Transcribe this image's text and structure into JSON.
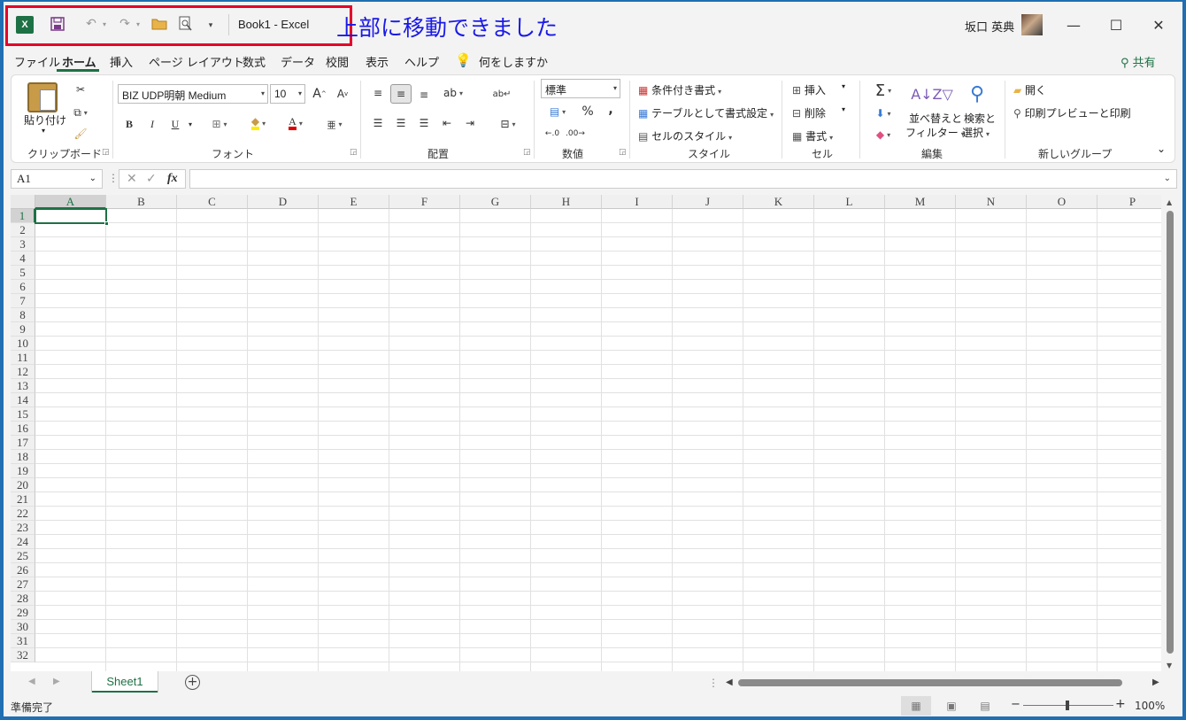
{
  "titlebar": {
    "doc_title": "Book1  -  Excel",
    "annotation": "上部に移動できました",
    "user_name": "坂口 英典",
    "excel_logo": "X",
    "minimize": "—",
    "maximize": "☐",
    "close": "✕"
  },
  "tabs": [
    {
      "label": "ファイル"
    },
    {
      "label": "ホーム"
    },
    {
      "label": "挿入"
    },
    {
      "label": "ページ レイアウト"
    },
    {
      "label": "数式"
    },
    {
      "label": "データ"
    },
    {
      "label": "校閲"
    },
    {
      "label": "表示"
    },
    {
      "label": "ヘルプ"
    }
  ],
  "tell_me": "何をしますか",
  "share": "共有",
  "ribbon": {
    "clipboard": {
      "paste": "貼り付け",
      "label": "クリップボード"
    },
    "font": {
      "name": "BIZ UDP明朝 Medium",
      "size": "10",
      "label": "フォント",
      "bold": "B",
      "italic": "I",
      "underline": "U"
    },
    "alignment": {
      "label": "配置"
    },
    "number": {
      "format": "標準",
      "label": "数値",
      "percent": "%",
      "comma": ","
    },
    "styles": {
      "conditional": "条件付き書式",
      "table": "テーブルとして書式設定",
      "cell_styles": "セルのスタイル",
      "label": "スタイル"
    },
    "cells": {
      "insert": "挿入",
      "delete": "削除",
      "format": "書式",
      "label": "セル"
    },
    "editing": {
      "sort_filter_1": "並べ替えと",
      "sort_filter_2": "フィルター",
      "find_1": "検索と",
      "find_2": "選択",
      "label": "編集"
    },
    "new_group": {
      "open": "開く",
      "print_preview": "印刷プレビューと印刷",
      "label": "新しいグループ"
    }
  },
  "formula_bar": {
    "name_box": "A1",
    "fx": "fx",
    "value": ""
  },
  "grid": {
    "columns": [
      "A",
      "B",
      "C",
      "D",
      "E",
      "F",
      "G",
      "H",
      "I",
      "J",
      "K",
      "L",
      "M",
      "N",
      "O",
      "P"
    ],
    "rows": [
      "1",
      "2",
      "3",
      "4",
      "5",
      "6",
      "7",
      "8",
      "9",
      "10",
      "11",
      "12",
      "13",
      "14",
      "15",
      "16",
      "17",
      "18",
      "19",
      "20",
      "21",
      "22",
      "23",
      "24",
      "25",
      "26",
      "27",
      "28",
      "29",
      "30",
      "31",
      "32"
    ],
    "active_cell": "A1"
  },
  "sheets": [
    "Sheet1"
  ],
  "status": {
    "text": "準備完了",
    "zoom": "100%"
  },
  "colors": {
    "accent": "#1e7145",
    "annotation": "#1a1ae6",
    "highlight": "#e4002b"
  }
}
